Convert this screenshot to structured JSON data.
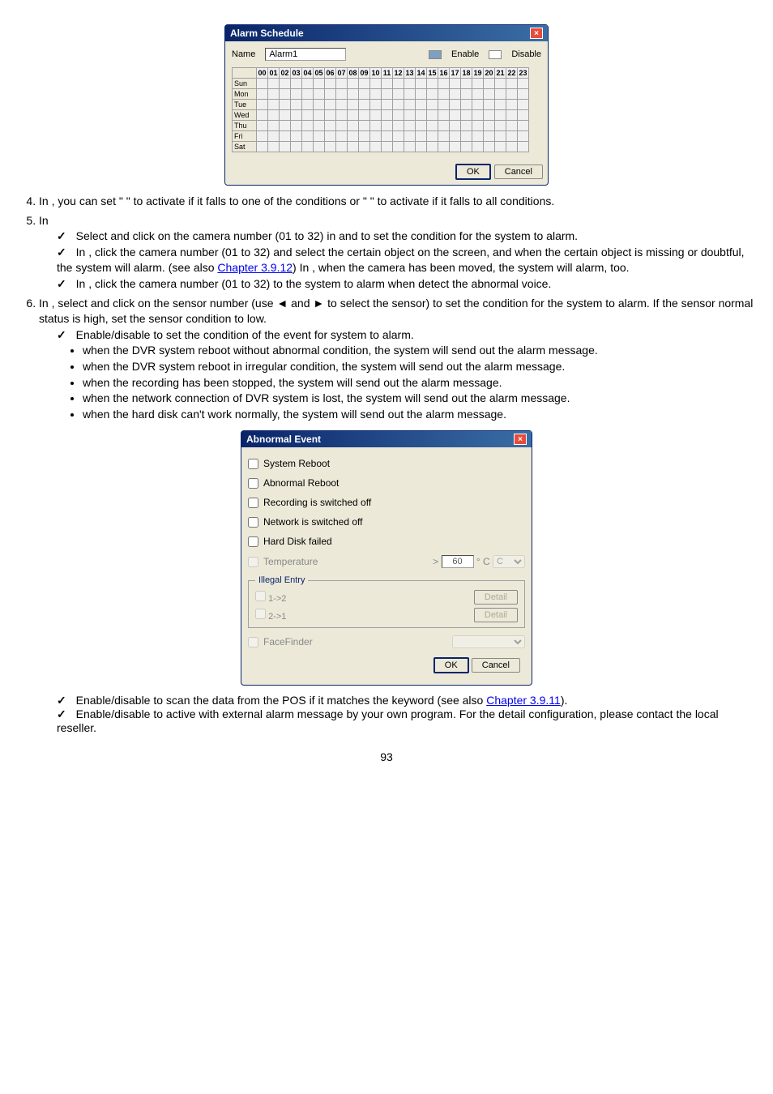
{
  "schedDialog": {
    "title": "Alarm Schedule",
    "nameLabel": "Name",
    "nameVal": "Alarm1",
    "enableLabel": "Enable",
    "disableLabel": "Disable",
    "hours": [
      "00",
      "01",
      "02",
      "03",
      "04",
      "05",
      "06",
      "07",
      "08",
      "09",
      "10",
      "11",
      "12",
      "13",
      "14",
      "15",
      "16",
      "17",
      "18",
      "19",
      "20",
      "21",
      "22",
      "23"
    ],
    "days": [
      "Sun",
      "Mon",
      "Tue",
      "Wed",
      "Thu",
      "Fri",
      "Sat"
    ],
    "ok": "OK",
    "cancel": "Cancel"
  },
  "steps": {
    "n4": {
      "a": "In ",
      "b": ", you can set \" ",
      "c": " \" to activate if it falls to one of the conditions or \" ",
      "d": " \" to activate if it falls to all conditions."
    },
    "n5": {
      "intro": "In",
      "c1a": "Select and click on the camera number (01 to 32) in ",
      "c1b": " and ",
      "c1c": " to set the condition for the system to alarm.",
      "c2a": "In ",
      "c2b": ", click the camera number (01 to 32) and select the certain object on the screen, and when the certain object is missing or doubtful, the system will alarm. (see also ",
      "c2link": "Chapter 3.9.12",
      "c2c": ") In ",
      "c2d": ", when the camera has been moved, the system will alarm, too.",
      "c3a": "In ",
      "c3b": ", click the camera number (01 to 32) to the system to alarm when detect the abnormal voice."
    },
    "n6": {
      "a": "In ",
      "b": ", select and click on the sensor number (use ◄ and ► to select the sensor) to set the condition for the system to alarm. If the sensor normal status is high, set the sensor condition to low.",
      "chk1": " Enable/disable to set the condition of the event for system to alarm.",
      "bul1": " when the DVR system reboot without abnormal condition, the system will send out the alarm message.",
      "bul2": " when the DVR system reboot in irregular condition, the system will send out the alarm message.",
      "bul3": " when the recording has been stopped, the system will send out the alarm message.",
      "bul4": " when the network connection of DVR system is lost, the system will send out the alarm message.",
      "bul5": " when the hard disk can't work normally, the system will send out the alarm message."
    }
  },
  "abnormal": {
    "title": "Abnormal Event",
    "sys": "System Reboot",
    "abn": "Abnormal Reboot",
    "rec": "Recording is switched off",
    "net": "Network is switched off",
    "hd": "Hard Disk failed",
    "temp": "Temperature",
    "gt": ">",
    "tempval": "60",
    "unit": "° C",
    "illegal": "Illegal Entry",
    "e12": "1->2",
    "e21": "2->1",
    "detail": "Detail",
    "face": "FaceFinder",
    "ok": "OK",
    "cancel": "Cancel"
  },
  "bottom": {
    "c1a": " Enable/disable to scan the data from the POS if it matches the keyword (see also ",
    "c1link": "Chapter 3.9.11",
    "c1b": ").",
    "c2": " Enable/disable to active with external alarm message by your own program. For the detail configuration, please contact the local reseller."
  },
  "page": "93"
}
